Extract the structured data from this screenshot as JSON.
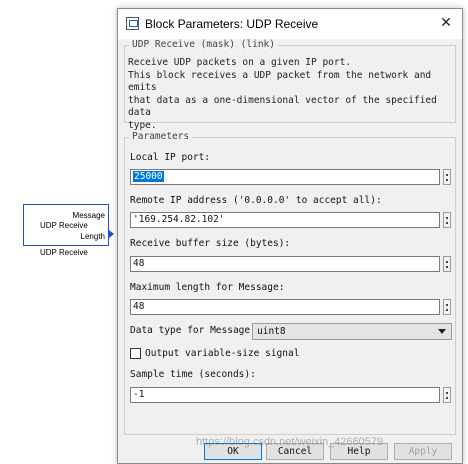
{
  "canvas_block": {
    "ports": [
      "Message",
      "UDP Receive",
      "Length"
    ],
    "name": "UDP Receive"
  },
  "dialog": {
    "title": "Block Parameters: UDP Receive",
    "close_glyph": "✕",
    "mask_heading": "UDP Receive (mask) (link)",
    "description_lines": [
      "Receive UDP packets on a given IP port.",
      "This block receives a UDP packet from the network and emits",
      "that data as a one-dimensional vector of the specified data",
      "type."
    ],
    "params_heading": "Parameters",
    "local_port": {
      "label": "Local IP port:",
      "value": "25000"
    },
    "remote_ip": {
      "label": "Remote IP address ('0.0.0.0' to accept all):",
      "value": "'169.254.82.102'"
    },
    "buffer_size": {
      "label": "Receive buffer size (bytes):",
      "value": "48"
    },
    "max_length": {
      "label": "Maximum length for Message:",
      "value": "48"
    },
    "data_type": {
      "label": "Data type for Message:",
      "value": "uint8"
    },
    "variable_size": {
      "label": "Output variable-size signal",
      "checked": false
    },
    "sample_time": {
      "label": "Sample time (seconds):",
      "value": "-1"
    },
    "buttons": {
      "ok": "OK",
      "cancel": "Cancel",
      "help": "Help",
      "apply": "Apply"
    }
  },
  "watermark": "https://blog.csdn.net/weixin_42660579",
  "colors": {
    "selection": "#0078d7",
    "block_border": "#1f4fd1"
  }
}
